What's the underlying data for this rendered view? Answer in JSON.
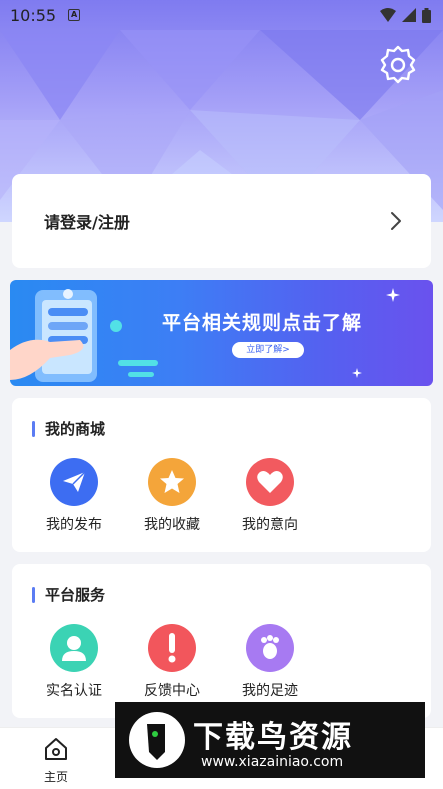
{
  "status_bar": {
    "time": "10:55"
  },
  "login": {
    "label": "请登录/注册"
  },
  "banner": {
    "title": "平台相关规则点击了解",
    "button": "立即了解>"
  },
  "sections": [
    {
      "title": "我的商城",
      "items": [
        {
          "label": "我的发布",
          "icon": "paper-plane-icon",
          "color": "#3d6df2"
        },
        {
          "label": "我的收藏",
          "icon": "star-icon",
          "color": "#f4a53a"
        },
        {
          "label": "我的意向",
          "icon": "heart-icon",
          "color": "#f25a5f"
        }
      ]
    },
    {
      "title": "平台服务",
      "items": [
        {
          "label": "实名认证",
          "icon": "user-verify-icon",
          "color": "#3bd3b4"
        },
        {
          "label": "反馈中心",
          "icon": "exclamation-icon",
          "color": "#f2565c"
        },
        {
          "label": "我的足迹",
          "icon": "footprint-icon",
          "color": "#a77af2"
        }
      ]
    }
  ],
  "nav": {
    "home": "主页"
  },
  "watermark": {
    "title": "下载鸟资源",
    "url": "www.xiazainiao.com"
  }
}
